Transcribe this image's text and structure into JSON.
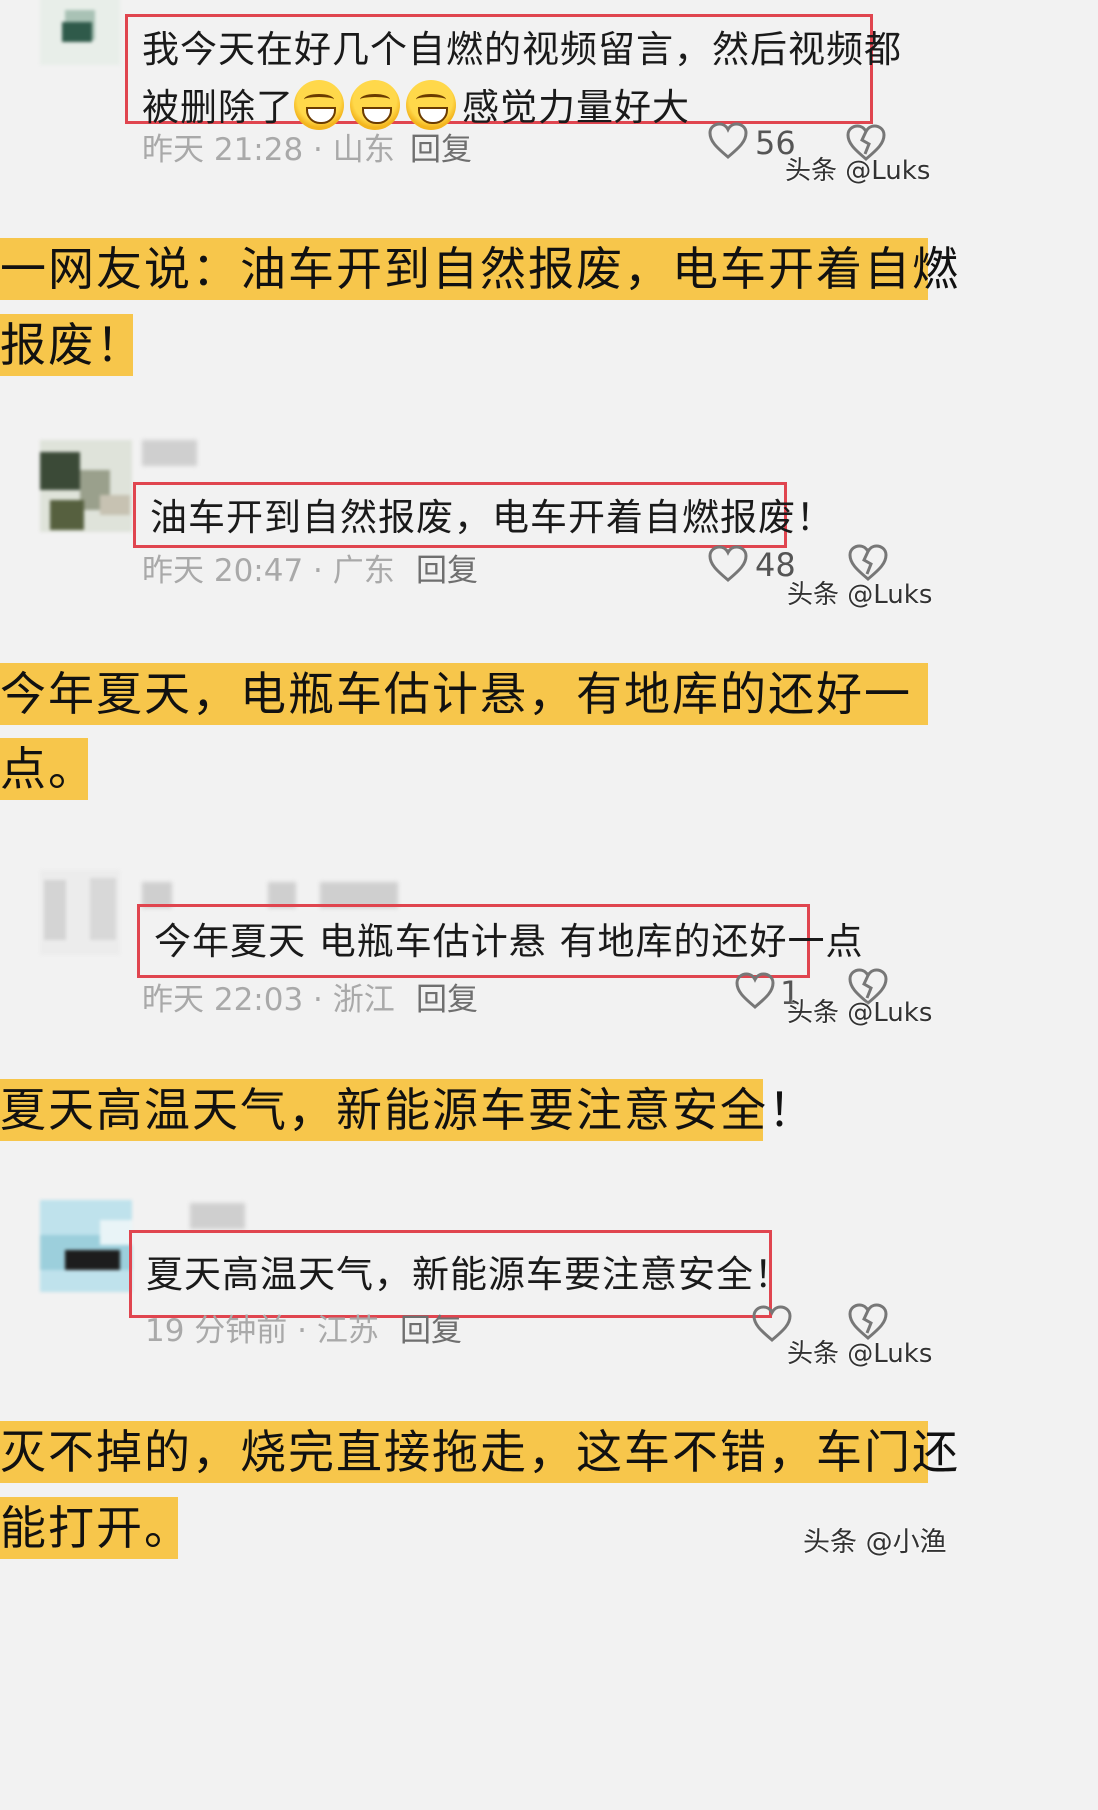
{
  "comments": [
    {
      "text_line1": "我今天在好几个自燃的视频留言，然后视频都",
      "text_line2_before": "被删除了",
      "text_line2_after": "感觉力量好大",
      "emoji_count": 3,
      "emoji_icon": "grinning-sweat-face",
      "time": "昨天 21:28 · 山东",
      "reply": "回复",
      "likes": "56",
      "watermark": "头条 @Luks"
    },
    {
      "text": "油车开到自然报废，电车开着自燃报废！",
      "time": "昨天 20:47 · 广东",
      "reply": "回复",
      "likes": "48",
      "watermark": "头条 @Luks"
    },
    {
      "text": "今年夏天 电瓶车估计悬 有地库的还好一点",
      "time": "昨天 22:03 · 浙江",
      "reply": "回复",
      "likes": "1",
      "watermark": "头条 @Luks"
    },
    {
      "text": "夏天高温天气，新能源车要注意安全！",
      "time": "19 分钟前 · 江苏",
      "reply": "回复",
      "likes": "",
      "watermark": "头条 @Luks"
    }
  ],
  "captions": [
    {
      "line1": "一网友说：油车开到自然报废，电车开着自燃",
      "line2": "报废！"
    },
    {
      "line1": "今年夏天，电瓶车估计悬，有地库的还好一",
      "line2": "点。"
    },
    {
      "line1": "夏天高温天气，新能源车要注意安全！"
    },
    {
      "line1": "灭不掉的，烧完直接拖走，这车不错，车门还",
      "line2": "能打开。"
    }
  ],
  "page_watermark": "头条 @小渔",
  "colors": {
    "highlight": "#f7c64b",
    "frame": "#e0454f",
    "background": "#f2f2f2"
  }
}
